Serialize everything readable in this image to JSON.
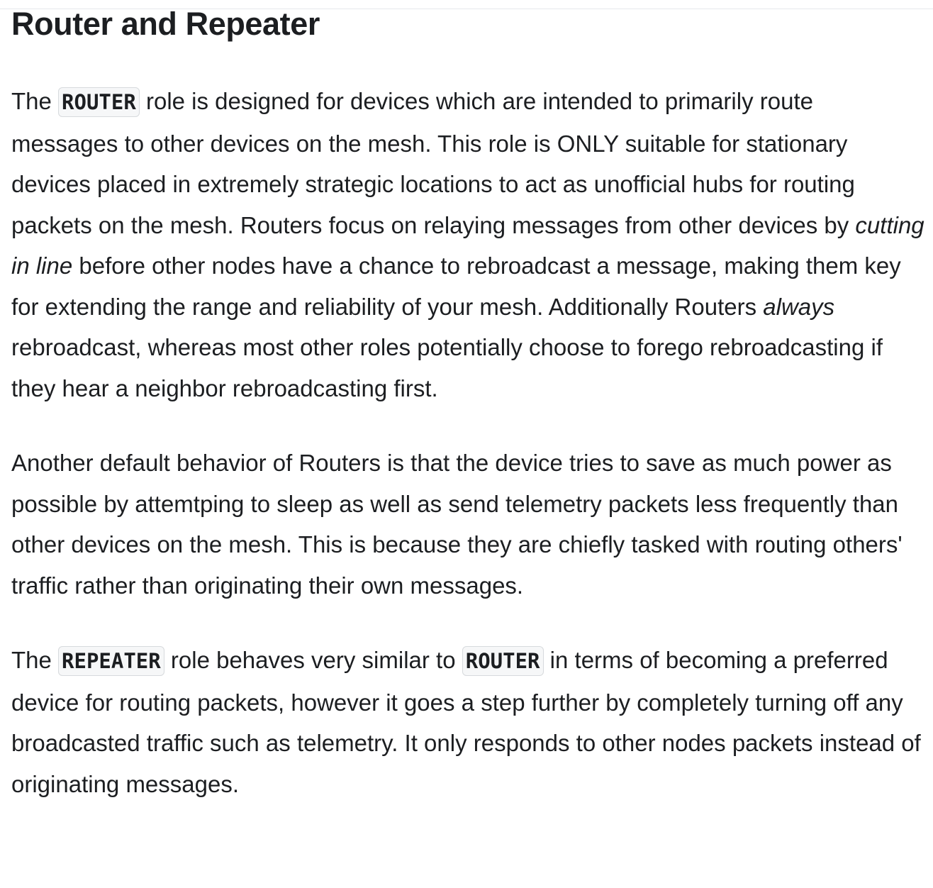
{
  "heading": "Router and Repeater",
  "paragraphs": [
    {
      "segments": [
        {
          "type": "text",
          "value": "The "
        },
        {
          "type": "code",
          "value": "ROUTER"
        },
        {
          "type": "text",
          "value": " role is designed for devices which are intended to primarily route messages to other devices on the mesh. This role is ONLY suitable for stationary devices placed in extremely strategic locations to act as unofficial hubs for routing packets on the mesh. Routers focus on relaying messages from other devices by "
        },
        {
          "type": "em",
          "value": "cutting in line"
        },
        {
          "type": "text",
          "value": " before other nodes have a chance to rebroadcast a message, making them key for extending the range and reliability of your mesh. Additionally Routers "
        },
        {
          "type": "em",
          "value": "always"
        },
        {
          "type": "text",
          "value": " rebroadcast, whereas most other roles potentially choose to forego rebroadcasting if they hear a neighbor rebroadcasting first."
        }
      ]
    },
    {
      "segments": [
        {
          "type": "text",
          "value": "Another default behavior of Routers is that the device tries to save as much power as possible by attemtping to sleep as well as send telemetry packets less frequently than other devices on the mesh. This is because they are chiefly tasked with routing others' traffic rather than originating their own messages."
        }
      ]
    },
    {
      "segments": [
        {
          "type": "text",
          "value": "The "
        },
        {
          "type": "code",
          "value": "REPEATER"
        },
        {
          "type": "text",
          "value": " role behaves very similar to "
        },
        {
          "type": "code",
          "value": "ROUTER"
        },
        {
          "type": "text",
          "value": " in terms of becoming a preferred device for routing packets, however it goes a step further by completely turning off any broadcasted traffic such as telemetry. It only responds to other nodes packets instead of originating messages."
        }
      ]
    }
  ]
}
